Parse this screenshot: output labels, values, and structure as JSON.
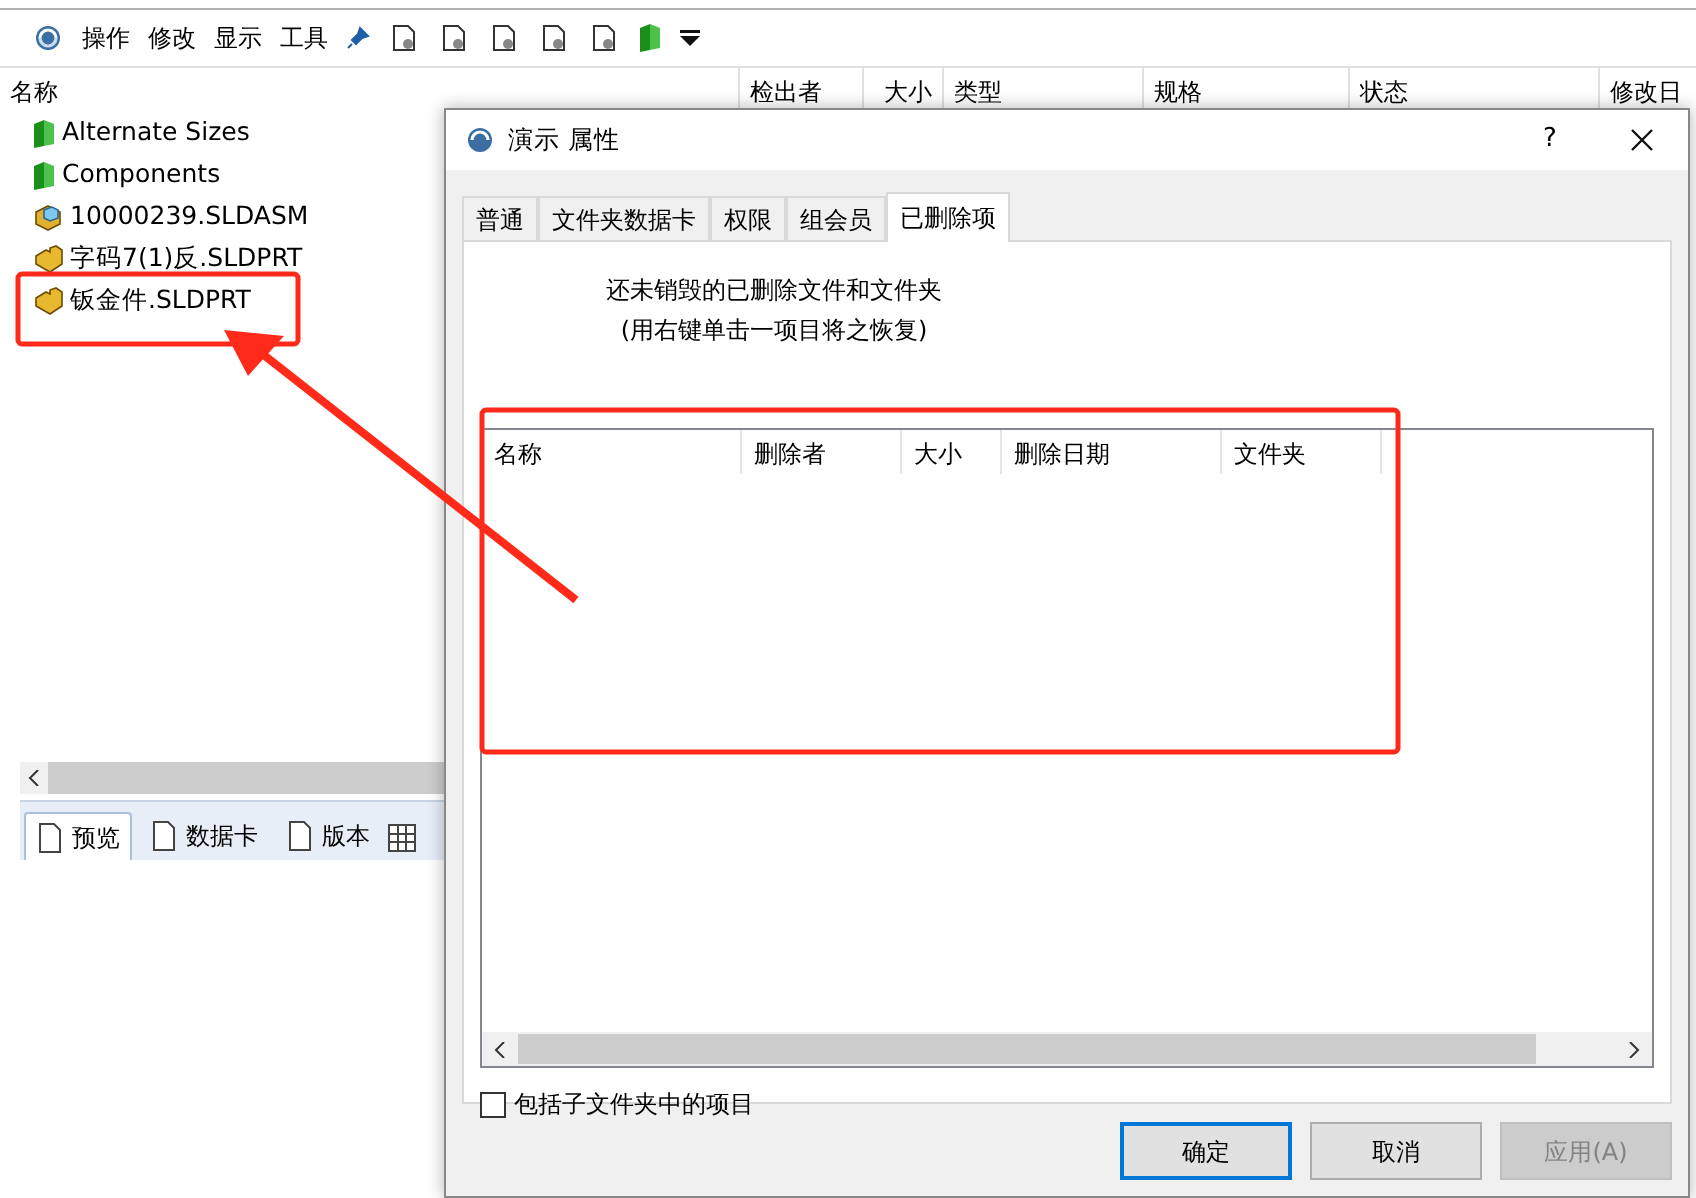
{
  "explorer": {
    "menu": [
      "操作",
      "修改",
      "显示",
      "工具"
    ],
    "columns": [
      "名称",
      "检出者",
      "大小",
      "类型",
      "规格",
      "状态",
      "修改日"
    ],
    "files": [
      {
        "name": "Alternate Sizes",
        "kind": "folder"
      },
      {
        "name": "Components",
        "kind": "folder"
      },
      {
        "name": "10000239.SLDASM",
        "kind": "assembly"
      },
      {
        "name": "字码7(1)反.SLDPRT",
        "kind": "part"
      },
      {
        "name": "钣金件.SLDPRT",
        "kind": "part"
      }
    ],
    "bottom_tabs": [
      {
        "label": "预览",
        "selected": true
      },
      {
        "label": "数据卡",
        "selected": false
      },
      {
        "label": "版本",
        "selected": false
      }
    ]
  },
  "dialog": {
    "title": "演示 属性",
    "help": "?",
    "tabs": [
      {
        "label": "普通",
        "selected": false
      },
      {
        "label": "文件夹数据卡",
        "selected": false
      },
      {
        "label": "权限",
        "selected": false
      },
      {
        "label": "组会员",
        "selected": false
      },
      {
        "label": "已删除项",
        "selected": true
      }
    ],
    "message": [
      "还未销毁的已删除文件和文件夹",
      "(用右键单击一项目将之恢复)"
    ],
    "list_columns": [
      "名称",
      "删除者",
      "大小",
      "删除日期",
      "文件夹"
    ],
    "include_subfolders": {
      "label": "包括子文件夹中的项目",
      "checked": false
    },
    "buttons": [
      {
        "label": "确定",
        "default": true,
        "disabled": false
      },
      {
        "label": "取消",
        "default": false,
        "disabled": false
      },
      {
        "label": "应用(A)",
        "default": false,
        "disabled": true
      }
    ]
  }
}
